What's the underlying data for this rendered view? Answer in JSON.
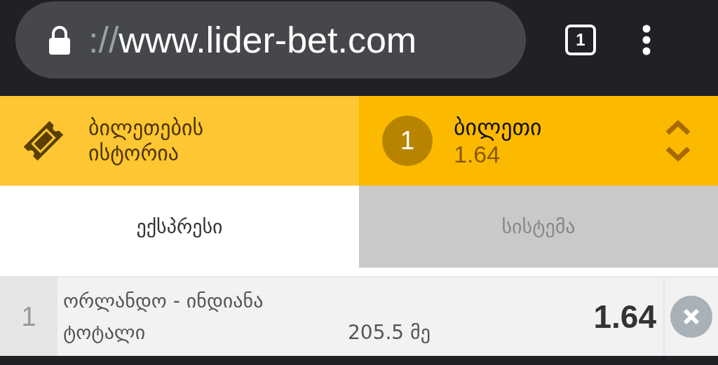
{
  "browser": {
    "url_scheme": "://",
    "url_host": "www.lider-bet.com",
    "tab_count": "1"
  },
  "ticket_bar": {
    "history_label": "ბილეთების ისტორია",
    "count": "1",
    "title": "ბილეთი",
    "total_odds": "1.64"
  },
  "tabs": [
    {
      "label": "ექსპრესი",
      "selected": true
    },
    {
      "label": "სისტემა",
      "selected": false
    }
  ],
  "bets": [
    {
      "number": "1",
      "event": "ორლანდო - ინდიანა",
      "market": "ტოტალი",
      "line": "205.5 მე",
      "odds": "1.64"
    }
  ]
}
